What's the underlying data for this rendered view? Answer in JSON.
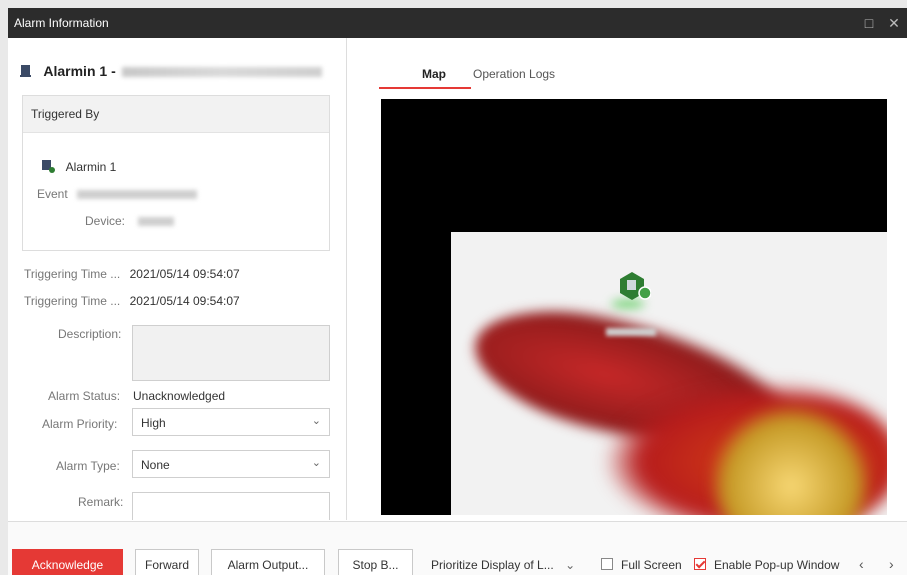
{
  "window": {
    "title": "Alarm Information"
  },
  "header": {
    "alarm_name": "Alarmin 1 -"
  },
  "triggered_by": {
    "section_label": "Triggered By",
    "source_name": "Alarmin 1",
    "event_label": "Event",
    "device_label": "Device:"
  },
  "details": {
    "triggering_time_1_label": "Triggering Time ...",
    "triggering_time_1_value": "2021/05/14 09:54:07",
    "triggering_time_2_label": "Triggering Time ...",
    "triggering_time_2_value": "2021/05/14 09:54:07",
    "description_label": "Description:",
    "alarm_status_label": "Alarm Status:",
    "alarm_status_value": "Unacknowledged",
    "alarm_priority_label": "Alarm Priority:",
    "alarm_priority_value": "High",
    "alarm_type_label": "Alarm Type:",
    "alarm_type_value": "None",
    "remark_label": "Remark:"
  },
  "tabs": {
    "map": "Map",
    "logs": "Operation Logs"
  },
  "actions": {
    "acknowledge": "Acknowledge",
    "forward": "Forward",
    "alarm_output": "Alarm Output...",
    "stop": "Stop B...",
    "prioritize": "Prioritize Display of L...",
    "full_screen": "Full Screen",
    "enable_popup": "Enable Pop-up Window"
  },
  "icons": {
    "alarm_input": "alarm-input-icon",
    "minimize": "maximize-icon",
    "close": "close-icon",
    "chevron": "chevron-down-icon",
    "prev": "chevron-left-icon",
    "next": "chevron-right-icon"
  },
  "colors": {
    "accent": "#e53935",
    "titlebar": "#2c2c2c",
    "map_marker": "#2e7d32"
  },
  "state": {
    "full_screen_checked": false,
    "enable_popup_checked": true
  }
}
